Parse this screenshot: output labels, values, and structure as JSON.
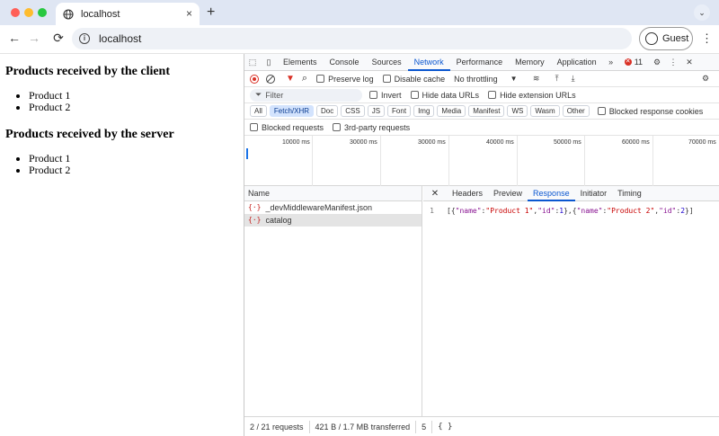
{
  "browser": {
    "tab_title": "localhost",
    "tab_close": "×",
    "new_tab": "+",
    "tab_menu": "⌄",
    "url": "localhost",
    "profile_label": "Guest",
    "back": "←",
    "forward": "→",
    "reload": "⟳",
    "menu": "⋮"
  },
  "page": {
    "client_heading": "Products received by the client",
    "client_items": [
      "Product 1",
      "Product 2"
    ],
    "server_heading": "Products received by the server",
    "server_items": [
      "Product 1",
      "Product 2"
    ]
  },
  "devtools": {
    "tabs": [
      "Elements",
      "Console",
      "Sources",
      "Network",
      "Performance",
      "Memory",
      "Application"
    ],
    "active_tab": "Network",
    "more_tabs": "»",
    "error_count": "11",
    "settings_glyph": "⚙",
    "menu_glyph": "⋮",
    "close_glyph": "✕",
    "toolbar": {
      "preserve_log": "Preserve log",
      "disable_cache": "Disable cache",
      "throttling": "No throttling",
      "search_glyph": "⌕",
      "upload_glyph": "⤒",
      "download_glyph": "⤓",
      "wifi_glyph": "≋"
    },
    "filter": {
      "placeholder": "Filter",
      "invert": "Invert",
      "hide_data_urls": "Hide data URLs",
      "hide_extension_urls": "Hide extension URLs"
    },
    "type_chips": [
      "All",
      "Fetch/XHR",
      "Doc",
      "CSS",
      "JS",
      "Font",
      "Img",
      "Media",
      "Manifest",
      "WS",
      "Wasm",
      "Other"
    ],
    "active_chip": "Fetch/XHR",
    "blocked_response_cookies": "Blocked response cookies",
    "blocked_requests": "Blocked requests",
    "third_party_requests": "3rd-party requests",
    "timeline_ticks": [
      "10000 ms",
      "30000 ms",
      "30000 ms",
      "40000 ms",
      "50000 ms",
      "60000 ms",
      "70000 ms"
    ],
    "name_column": "Name",
    "requests": [
      {
        "icon": "{·}",
        "name": "_devMiddlewareManifest.json",
        "selected": false
      },
      {
        "icon": "{·}",
        "name": "catalog",
        "selected": true
      }
    ],
    "detail_tabs": [
      "Headers",
      "Preview",
      "Response",
      "Initiator",
      "Timing"
    ],
    "active_detail_tab": "Response",
    "response_line_number": "1",
    "response_body": [
      {
        "t": "p",
        "v": "[{"
      },
      {
        "t": "k",
        "v": "\"name\""
      },
      {
        "t": "p",
        "v": ":"
      },
      {
        "t": "s",
        "v": "\"Product 1\""
      },
      {
        "t": "p",
        "v": ","
      },
      {
        "t": "k",
        "v": "\"id\""
      },
      {
        "t": "p",
        "v": ":"
      },
      {
        "t": "n",
        "v": "1"
      },
      {
        "t": "p",
        "v": "},{"
      },
      {
        "t": "k",
        "v": "\"name\""
      },
      {
        "t": "p",
        "v": ":"
      },
      {
        "t": "s",
        "v": "\"Product 2\""
      },
      {
        "t": "p",
        "v": ","
      },
      {
        "t": "k",
        "v": "\"id\""
      },
      {
        "t": "p",
        "v": ":"
      },
      {
        "t": "n",
        "v": "2"
      },
      {
        "t": "p",
        "v": "}]"
      }
    ],
    "status": {
      "requests": "2 / 21 requests",
      "transferred": "421 B / 1.7 MB transferred",
      "truncated": "5",
      "braces": "{ }"
    }
  }
}
